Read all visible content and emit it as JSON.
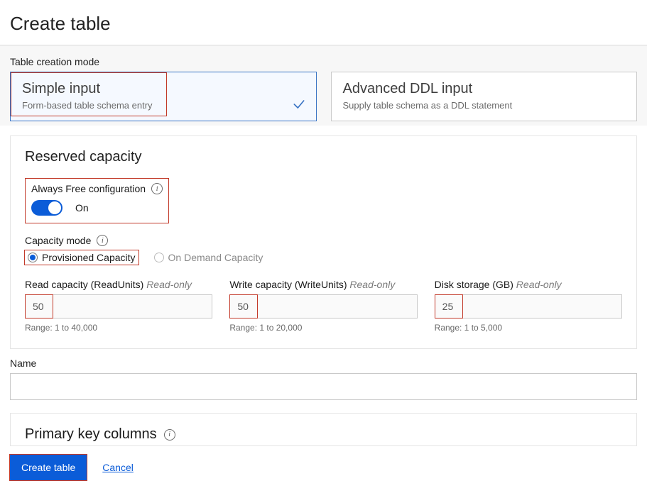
{
  "header": {
    "title": "Create table"
  },
  "creationMode": {
    "label": "Table creation mode",
    "options": [
      {
        "title": "Simple input",
        "desc": "Form-based table schema entry",
        "selected": true
      },
      {
        "title": "Advanced DDL input",
        "desc": "Supply table schema as a DDL statement",
        "selected": false
      }
    ]
  },
  "reserved": {
    "title": "Reserved capacity",
    "alwaysFree": {
      "label": "Always Free configuration",
      "valueLabel": "On"
    },
    "capacityMode": {
      "label": "Capacity mode",
      "options": [
        {
          "label": "Provisioned Capacity",
          "selected": true
        },
        {
          "label": "On Demand Capacity",
          "selected": false
        }
      ]
    },
    "capacities": [
      {
        "label": "Read capacity (ReadUnits)",
        "readonly": "Read-only",
        "value": "50",
        "range": "Range: 1 to 40,000"
      },
      {
        "label": "Write capacity (WriteUnits)",
        "readonly": "Read-only",
        "value": "50",
        "range": "Range: 1 to 20,000"
      },
      {
        "label": "Disk storage (GB)",
        "readonly": "Read-only",
        "value": "25",
        "range": "Range: 1 to 5,000"
      }
    ]
  },
  "name": {
    "label": "Name",
    "value": ""
  },
  "primaryKeys": {
    "title": "Primary key columns"
  },
  "footer": {
    "create": "Create table",
    "cancel": "Cancel"
  }
}
